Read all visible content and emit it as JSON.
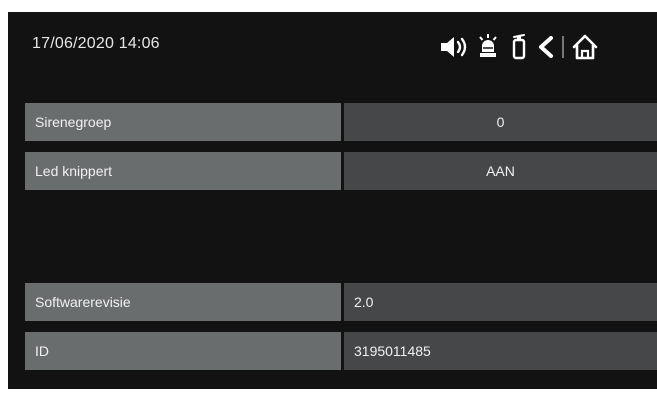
{
  "header": {
    "datetime": "17/06/2020 14:06",
    "icons": [
      "moon-icon",
      "speaker-icon",
      "alarm-beacon-icon",
      "fire-extinguisher-icon",
      "back-icon",
      "home-icon"
    ]
  },
  "settings": [
    {
      "label": "Sirenegroep",
      "value": "0"
    },
    {
      "label": "Led knippert",
      "value": "AAN"
    }
  ],
  "info": [
    {
      "label": "Softwarerevisie",
      "value": "2.0"
    },
    {
      "label": "ID",
      "value": "3195011485"
    }
  ],
  "colors": {
    "background": "#121212",
    "label_cell": "#6a6d6e",
    "value_cell": "#454748",
    "text": "#f0f0f0"
  }
}
